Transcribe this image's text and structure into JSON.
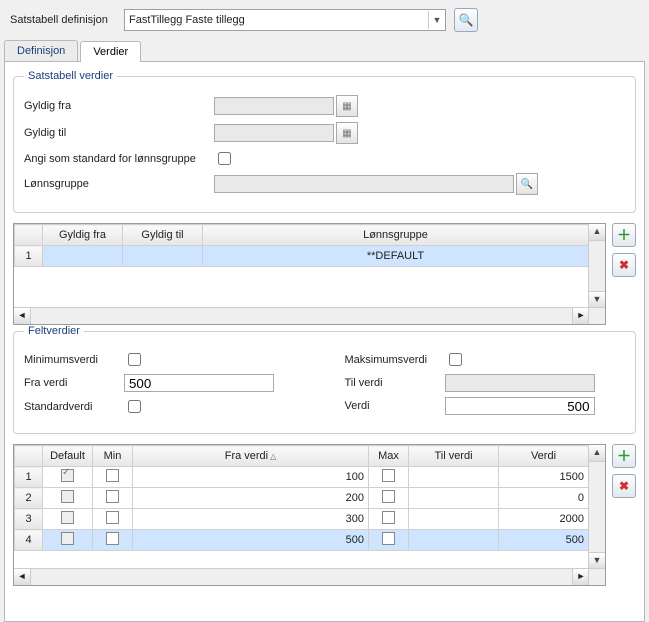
{
  "top": {
    "label": "Satstabell definisjon",
    "combo_value": "FastTillegg Faste tillegg"
  },
  "tabs": {
    "definisjon": "Definisjon",
    "verdier": "Verdier"
  },
  "satstabell": {
    "legend": "Satstabell verdier",
    "gyldig_fra_label": "Gyldig fra",
    "gyldig_fra": "",
    "gyldig_til_label": "Gyldig til",
    "gyldig_til": "",
    "angi_std_label": "Angi som standard for lønnsgruppe",
    "angi_std": false,
    "lonnsgruppe_label": "Lønnsgruppe",
    "lonnsgruppe": ""
  },
  "grid1": {
    "headers": {
      "gyldig_fra": "Gyldig fra",
      "gyldig_til": "Gyldig til",
      "lonnsgruppe": "Lønnsgruppe"
    },
    "rows": [
      {
        "n": "1",
        "gyldig_fra": "",
        "gyldig_til": "",
        "lonnsgruppe": "**DEFAULT"
      }
    ],
    "selected_index": 0
  },
  "feltverdier": {
    "legend": "Feltverdier",
    "min_label": "Minimumsverdi",
    "min": false,
    "max_label": "Maksimumsverdi",
    "max": false,
    "fra_label": "Fra verdi",
    "fra": "500",
    "til_label": "Til verdi",
    "til": "",
    "std_label": "Standardverdi",
    "std": false,
    "verdi_label": "Verdi",
    "verdi": "500"
  },
  "grid2": {
    "headers": {
      "default": "Default",
      "min": "Min",
      "fra": "Fra verdi",
      "max": "Max",
      "til": "Til verdi",
      "verdi": "Verdi"
    },
    "rows": [
      {
        "n": "1",
        "default": true,
        "min": false,
        "fra": "100",
        "max": false,
        "til": "",
        "verdi": "1500"
      },
      {
        "n": "2",
        "default": false,
        "min": false,
        "fra": "200",
        "max": false,
        "til": "",
        "verdi": "0"
      },
      {
        "n": "3",
        "default": false,
        "min": false,
        "fra": "300",
        "max": false,
        "til": "",
        "verdi": "2000"
      },
      {
        "n": "4",
        "default": false,
        "min": false,
        "fra": "500",
        "max": false,
        "til": "",
        "verdi": "500"
      }
    ],
    "selected_index": 3
  }
}
